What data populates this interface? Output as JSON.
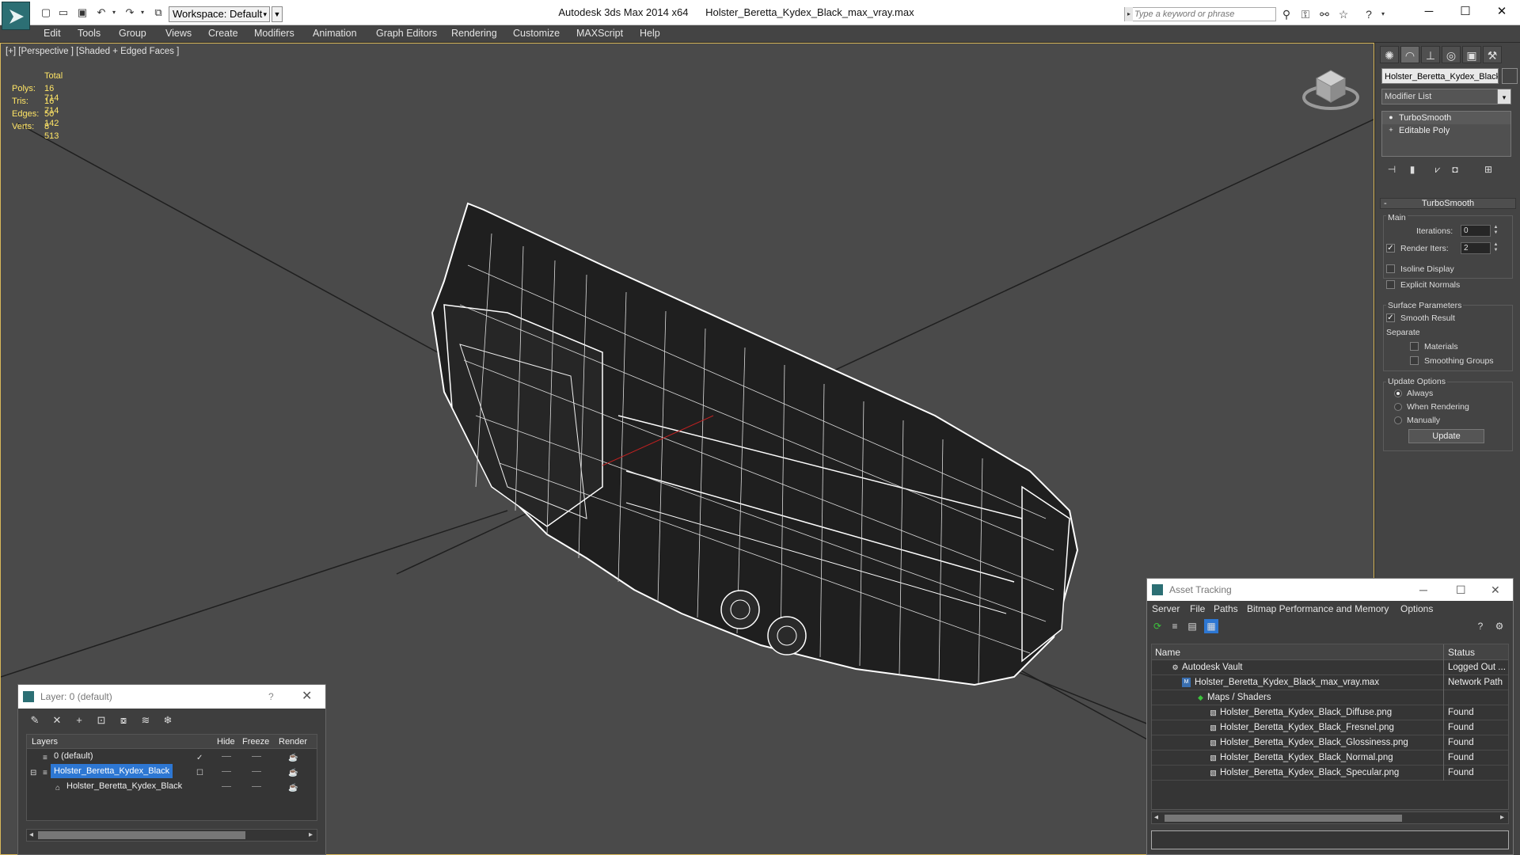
{
  "titlebar": {
    "workspace": "Workspace: Default",
    "app_title": "Autodesk 3ds Max  2014 x64",
    "file_name": "Holster_Beretta_Kydex_Black_max_vray.max",
    "search_placeholder": "Type a keyword or phrase",
    "minimize": "─",
    "maximize": "☐",
    "close": "✕"
  },
  "menu": [
    "Edit",
    "Tools",
    "Group",
    "Views",
    "Create",
    "Modifiers",
    "Animation",
    "Graph Editors",
    "Rendering",
    "Customize",
    "MAXScript",
    "Help"
  ],
  "viewport": {
    "label": "[+] [Perspective ] [Shaded + Edged Faces ]",
    "stats": {
      "header": "Total",
      "polys_label": "Polys:",
      "polys": "16 714",
      "tris_label": "Tris:",
      "tris": "16 714",
      "edges_label": "Edges:",
      "edges": "50 142",
      "verts_label": "Verts:",
      "verts": "8 513"
    }
  },
  "command_panel": {
    "object_name": "Holster_Beretta_Kydex_Black",
    "modifier_list": "Modifier List",
    "stack": [
      {
        "label": "TurboSmooth",
        "icon": "bulb-icon"
      },
      {
        "label": "Editable Poly",
        "icon": "poly-icon"
      }
    ],
    "rollout_title": "TurboSmooth",
    "main_label": "Main",
    "iterations_label": "Iterations:",
    "iterations_value": "0",
    "render_iters_label": "Render Iters:",
    "render_iters_value": "2",
    "isoline_label": "Isoline Display",
    "explicit_normals_label": "Explicit Normals",
    "surface_params_label": "Surface Parameters",
    "smooth_result_label": "Smooth Result",
    "separate_label": "Separate",
    "materials_label": "Materials",
    "smoothing_groups_label": "Smoothing Groups",
    "update_options_label": "Update Options",
    "always_label": "Always",
    "when_rendering_label": "When Rendering",
    "manually_label": "Manually",
    "update_button": "Update"
  },
  "layer_window": {
    "title": "Layer: 0 (default)",
    "help": "?",
    "close": "✕",
    "columns": {
      "layers": "Layers",
      "hide": "Hide",
      "freeze": "Freeze",
      "render": "Render"
    },
    "rows": [
      {
        "name": "0 (default)"
      },
      {
        "name": "Holster_Beretta_Kydex_Black"
      },
      {
        "name": "Holster_Beretta_Kydex_Black"
      }
    ]
  },
  "asset_tracking": {
    "title": "Asset Tracking",
    "menu": [
      "Server",
      "File",
      "Paths",
      "Bitmap Performance and Memory",
      "Options"
    ],
    "columns": {
      "name": "Name",
      "status": "Status"
    },
    "rows": [
      {
        "name": "Autodesk Vault",
        "status": "Logged Out ..."
      },
      {
        "name": "Holster_Beretta_Kydex_Black_max_vray.max",
        "status": "Network Path"
      },
      {
        "name": "Maps / Shaders",
        "status": ""
      },
      {
        "name": "Holster_Beretta_Kydex_Black_Diffuse.png",
        "status": "Found"
      },
      {
        "name": "Holster_Beretta_Kydex_Black_Fresnel.png",
        "status": "Found"
      },
      {
        "name": "Holster_Beretta_Kydex_Black_Glossiness.png",
        "status": "Found"
      },
      {
        "name": "Holster_Beretta_Kydex_Black_Normal.png",
        "status": "Found"
      },
      {
        "name": "Holster_Beretta_Kydex_Black_Specular.png",
        "status": "Found"
      }
    ]
  },
  "colors": {
    "viewport_bg": "#4a4a4a",
    "stats_text": "#ffe566",
    "selection": "#2d77d3"
  }
}
